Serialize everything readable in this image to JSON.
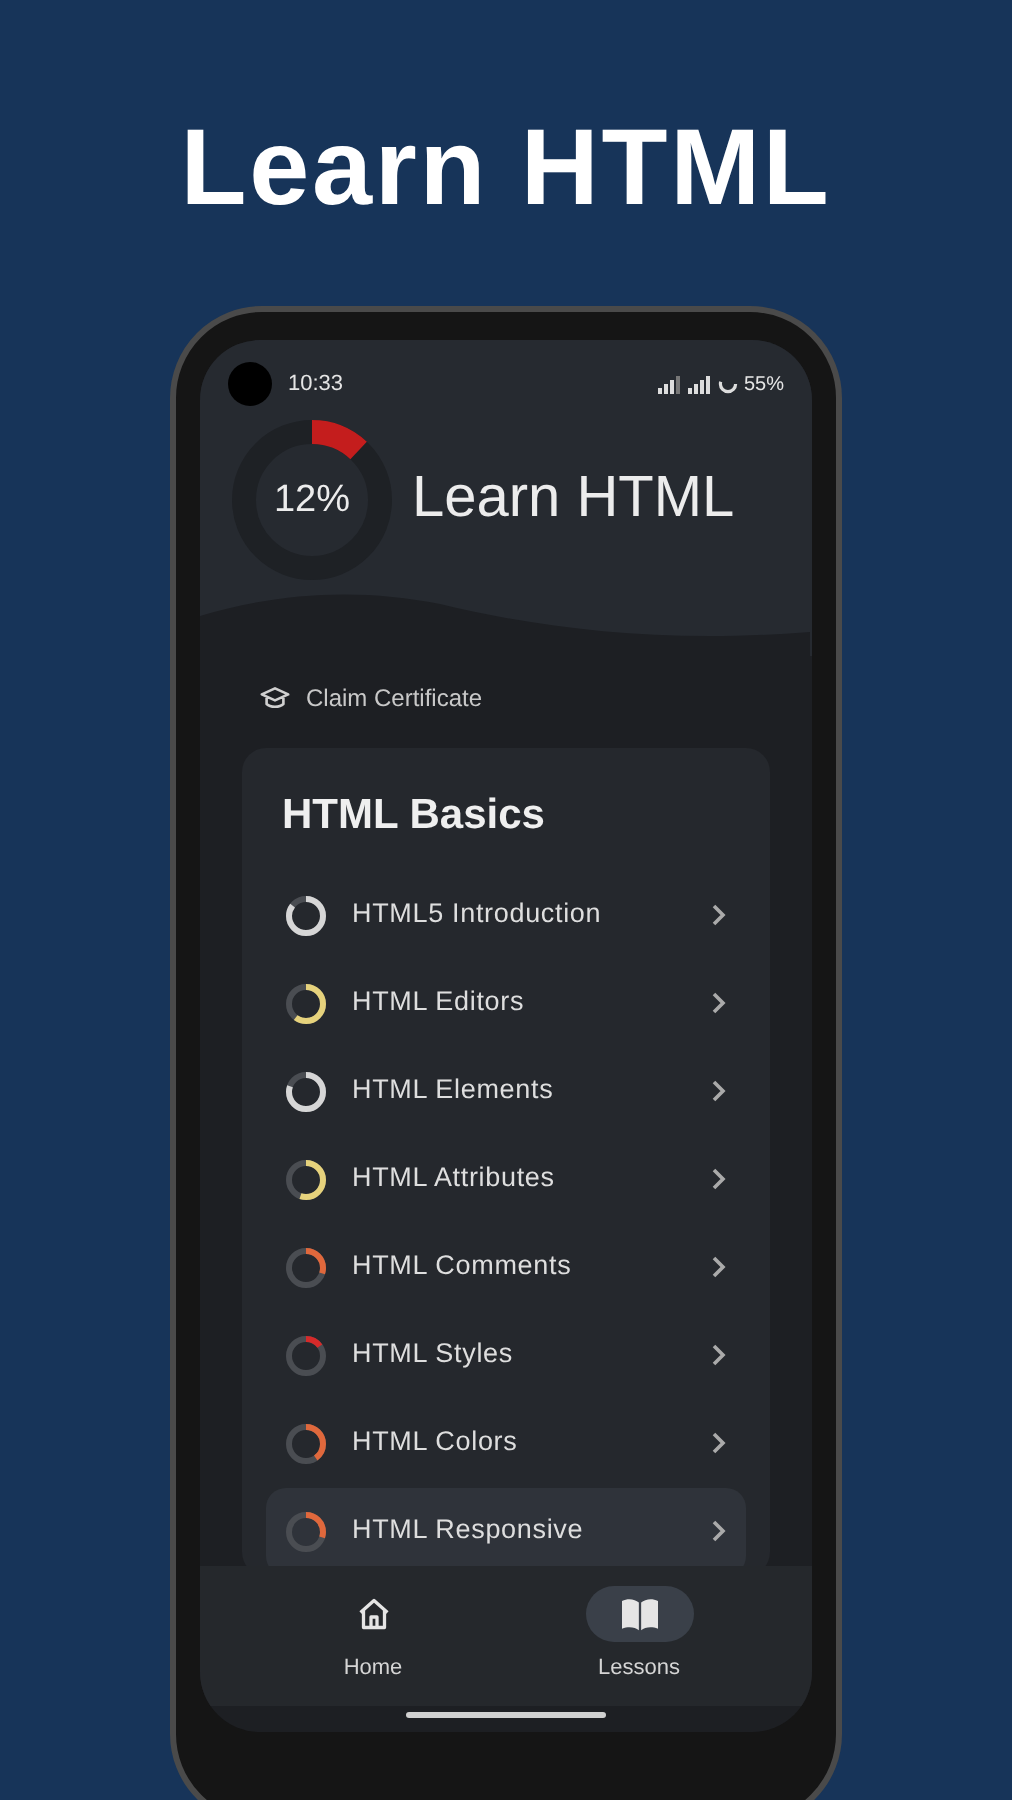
{
  "banner": {
    "title": "Learn HTML"
  },
  "status_bar": {
    "time": "10:33",
    "battery": "55%"
  },
  "header": {
    "progress": {
      "level": 0.12,
      "reading": "12%"
    },
    "title": "Learn HTML"
  },
  "claim_link": "Claim Certificate",
  "section": {
    "title": "HTML Basics",
    "lessons": [
      {
        "title": "HTML5 Introduction",
        "level": 0.85,
        "color": "#d6d6d6",
        "selected": false
      },
      {
        "title": "HTML Editors",
        "level": 0.6,
        "color": "#e6d27c",
        "selected": false
      },
      {
        "title": "HTML Elements",
        "level": 0.8,
        "color": "#d6d6d6",
        "selected": false
      },
      {
        "title": "HTML Attributes",
        "level": 0.55,
        "color": "#e6d27c",
        "selected": false
      },
      {
        "title": "HTML Comments",
        "level": 0.3,
        "color": "#e0683c",
        "selected": false
      },
      {
        "title": "HTML Styles",
        "level": 0.15,
        "color": "#d62a2a",
        "selected": false
      },
      {
        "title": "HTML Colors",
        "level": 0.4,
        "color": "#e0683c",
        "selected": false
      },
      {
        "title": "HTML Responsive",
        "level": 0.3,
        "color": "#e0683c",
        "selected": true
      }
    ]
  },
  "nav": [
    {
      "kind": "home",
      "label": "Home",
      "selected": false
    },
    {
      "kind": "lessons",
      "label": "Lessons",
      "selected": true
    }
  ]
}
